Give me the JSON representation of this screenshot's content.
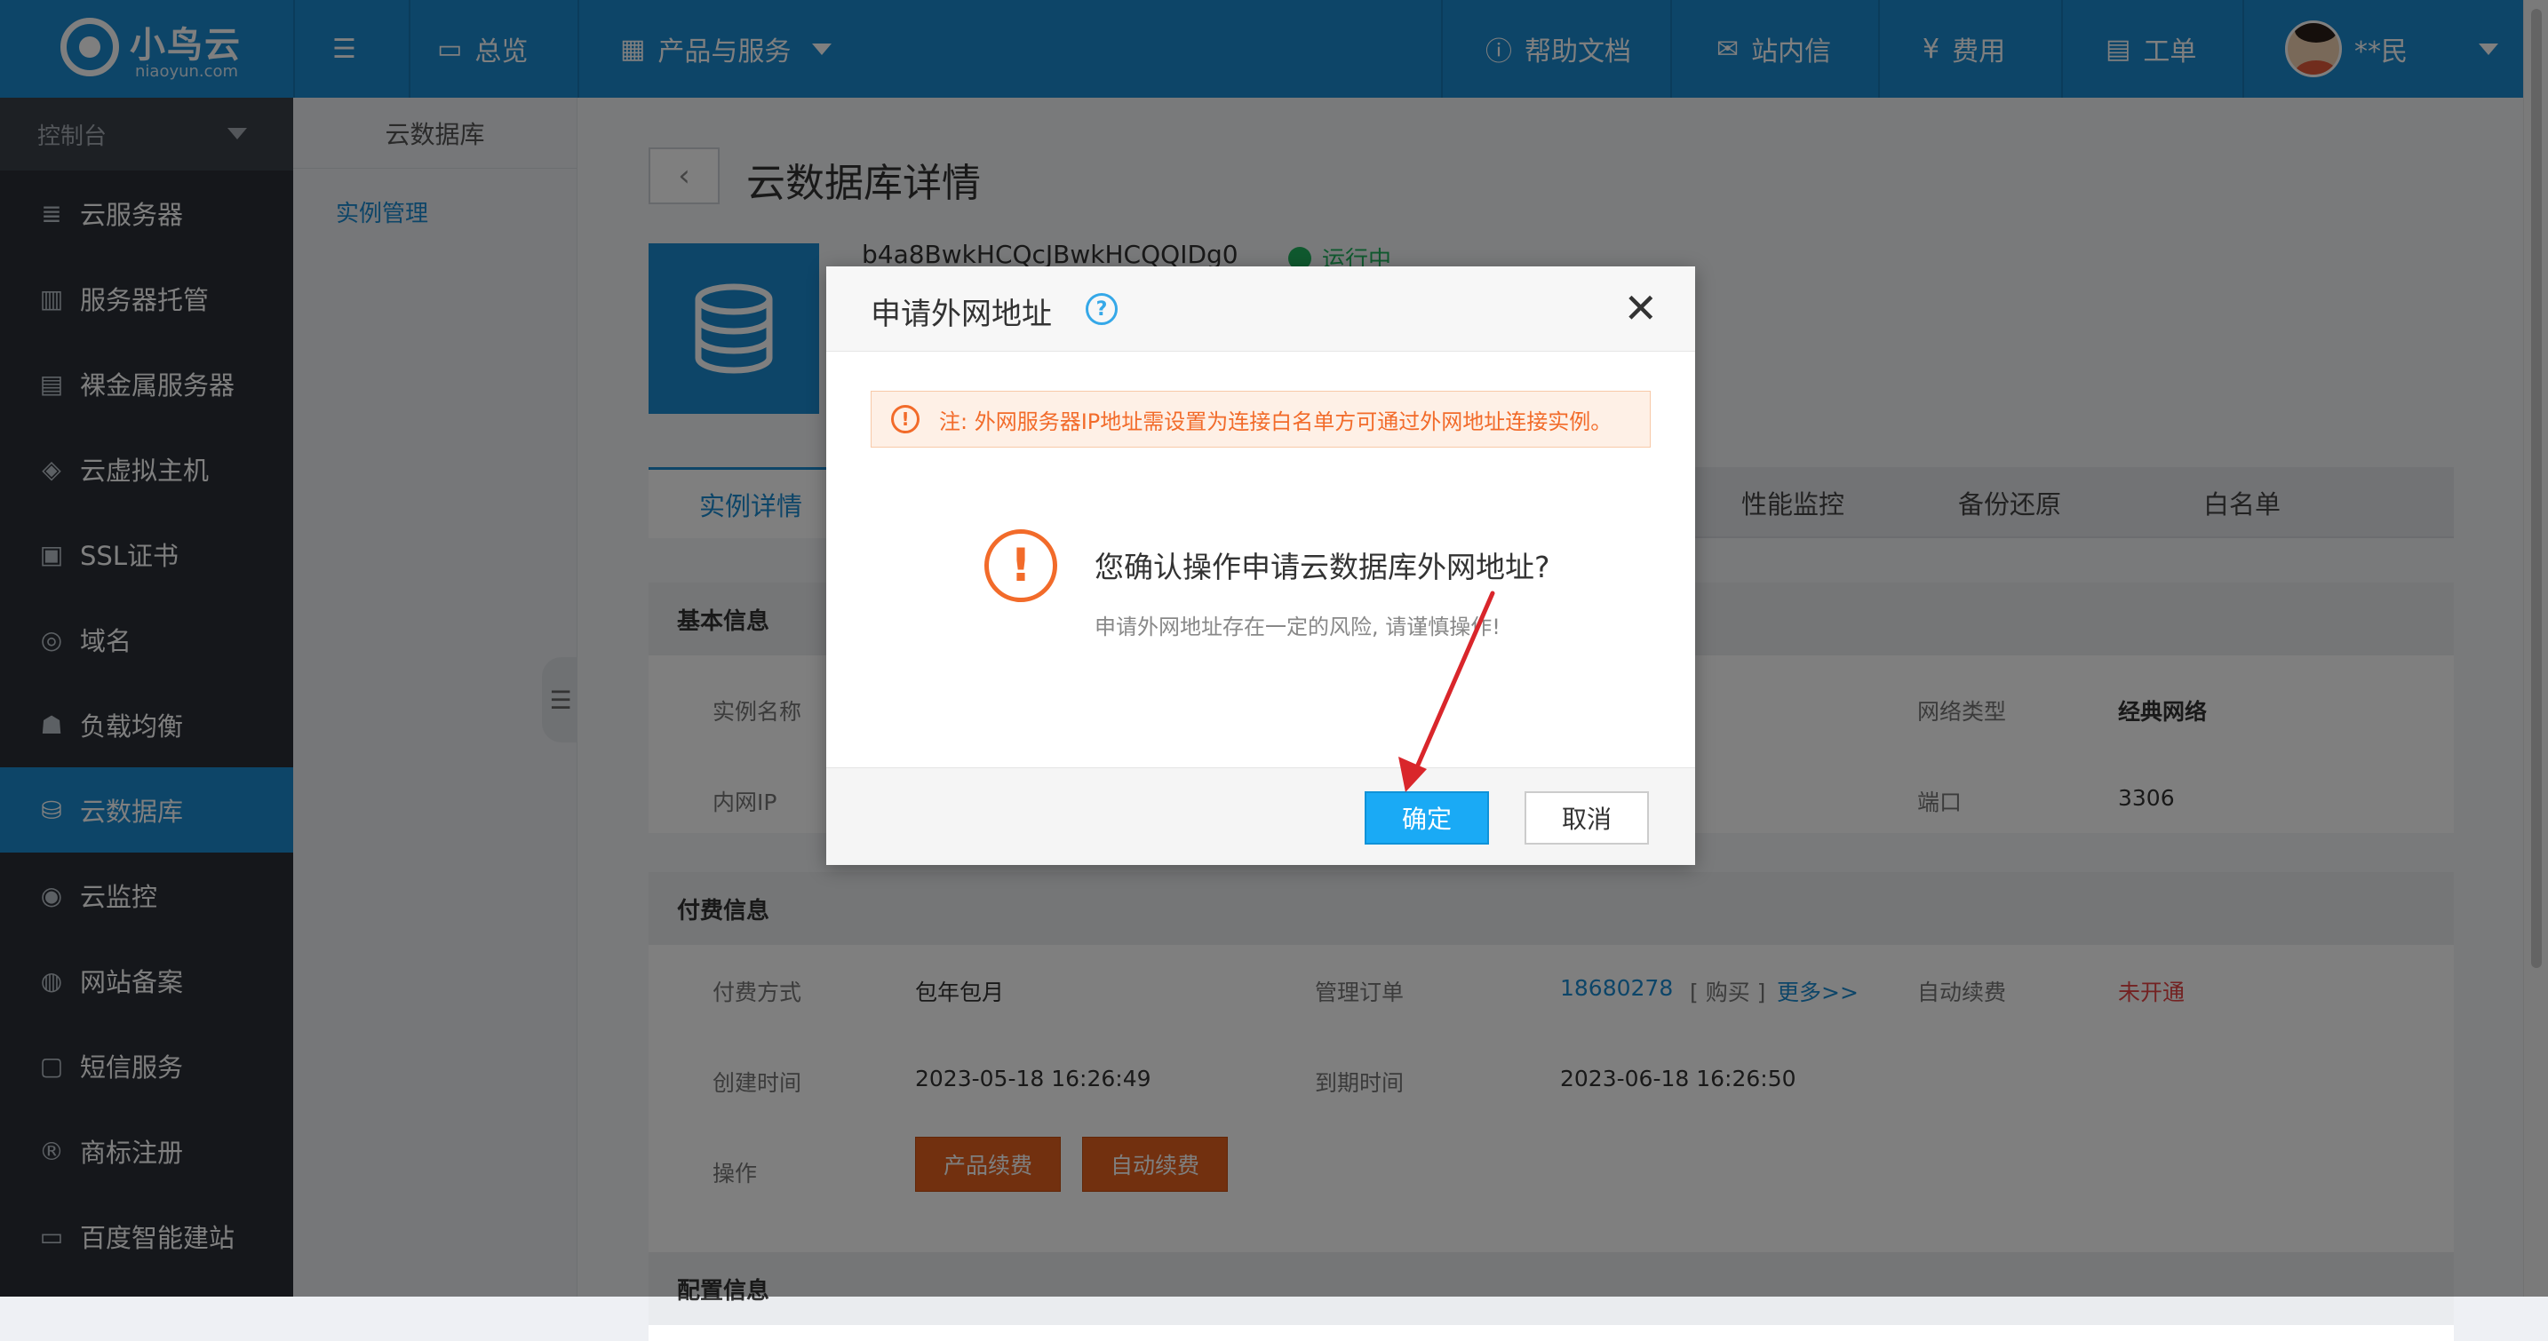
{
  "brand": {
    "name": "小鸟云",
    "domain": "niaoyun.com"
  },
  "topbar": {
    "overview": "总览",
    "products": "产品与服务",
    "help": "帮助文档",
    "messages": "站内信",
    "billing": "费用",
    "tickets": "工单",
    "user": "**民"
  },
  "sidebar": {
    "console": "控制台",
    "items": [
      {
        "label": "云服务器",
        "icon": "server-icon"
      },
      {
        "label": "服务器托管",
        "icon": "rack-icon"
      },
      {
        "label": "裸金属服务器",
        "icon": "baremetal-icon"
      },
      {
        "label": "云虚拟主机",
        "icon": "cube-icon"
      },
      {
        "label": "SSL证书",
        "icon": "certificate-icon"
      },
      {
        "label": "域名",
        "icon": "globe-icon"
      },
      {
        "label": "负载均衡",
        "icon": "balance-icon"
      },
      {
        "label": "云数据库",
        "icon": "database-icon"
      },
      {
        "label": "云监控",
        "icon": "monitor-icon"
      },
      {
        "label": "网站备案",
        "icon": "filing-icon"
      },
      {
        "label": "短信服务",
        "icon": "sms-icon"
      },
      {
        "label": "商标注册",
        "icon": "trademark-icon"
      },
      {
        "label": "百度智能建站",
        "icon": "site-builder-icon"
      }
    ]
  },
  "subnav": {
    "title": "云数据库",
    "link": "实例管理"
  },
  "page": {
    "title": "云数据库详情",
    "instance_id": "b4a8BwkHCQcJBwkHCQQIDg0",
    "status": "运行中"
  },
  "tabs": [
    "实例详情",
    "性能监控",
    "备份还原",
    "白名单"
  ],
  "basic": {
    "heading": "基本信息",
    "instance_name_label": "实例名称",
    "network_type_label": "网络类型",
    "network_type": "经典网络",
    "internal_ip_label": "内网IP",
    "port_label": "端口",
    "port": "3306"
  },
  "payment": {
    "heading": "付费信息",
    "method_label": "付费方式",
    "method": "包年包月",
    "order_label": "管理订单",
    "order_no": "18680278",
    "order_buy": "[ 购买 ]",
    "more": "更多>>",
    "auto_renew_label": "自动续费",
    "auto_renew": "未开通",
    "created_label": "创建时间",
    "created": "2023-05-18 16:26:49",
    "expire_label": "到期时间",
    "expire": "2023-06-18 16:26:50",
    "ops_label": "操作",
    "renew_button": "产品续费",
    "auto_renew_button": "自动续费"
  },
  "config": {
    "heading": "配置信息"
  },
  "modal": {
    "title": "申请外网地址",
    "notice": "注: 外网服务器IP地址需设置为连接白名单方可通过外网地址连接实例。",
    "question": "您确认操作申请云数据库外网地址?",
    "risk": "申请外网地址存在一定的风险, 请谨慎操作!",
    "confirm": "确定",
    "cancel": "取消"
  },
  "colors": {
    "primary": "#1a8ad1",
    "warning": "#f26b2a",
    "accent_button": "#1aaaf5",
    "orange_button": "#e4611e",
    "running": "#21b35f",
    "annotation_arrow": "#d9262b"
  }
}
